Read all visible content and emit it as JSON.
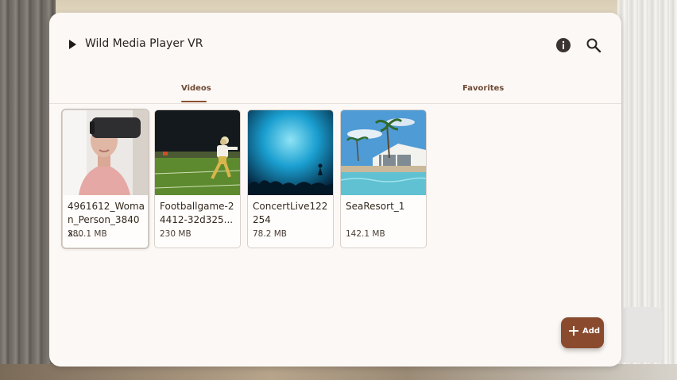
{
  "app": {
    "title": "Wild Media Player VR"
  },
  "toolbar": {
    "info_icon": "info-icon",
    "search_icon": "search-icon"
  },
  "tabs": [
    {
      "label": "Videos",
      "active": true
    },
    {
      "label": "Favorites",
      "active": false
    }
  ],
  "videos": [
    {
      "title": "4961612_Woman_Person_3840x...",
      "size": "380.1 MB",
      "thumbnail": "woman-vr-headset"
    },
    {
      "title": "Footballgame-24412-32d325...",
      "size": "230 MB",
      "thumbnail": "football-player"
    },
    {
      "title": "ConcertLive122254",
      "size": "78.2 MB",
      "thumbnail": "concert-crowd"
    },
    {
      "title": "SeaResort_1",
      "size": "142.1 MB",
      "thumbnail": "sea-resort-pool"
    }
  ],
  "fab": {
    "label": "Add",
    "icon": "plus-icon"
  },
  "colors": {
    "accent": "#8a4a2d",
    "panel": "#fcf8f5",
    "tab_text": "#6e4a35"
  }
}
